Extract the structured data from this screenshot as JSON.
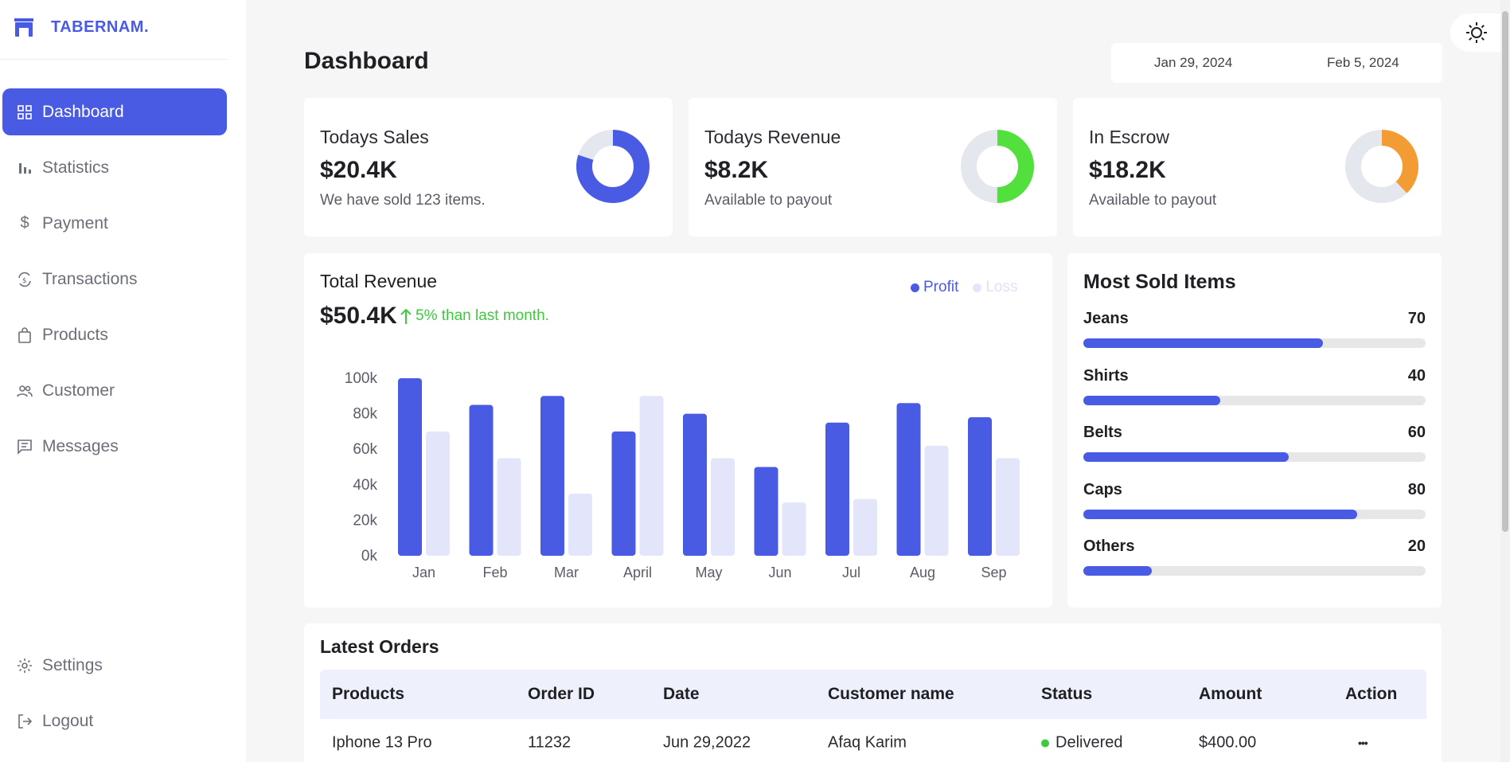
{
  "brand": {
    "name": "TABERNAM."
  },
  "nav": [
    {
      "label": "Dashboard",
      "icon": "grid-icon",
      "active": true
    },
    {
      "label": "Statistics",
      "icon": "bar-chart-icon"
    },
    {
      "label": "Payment",
      "icon": "dollar-icon"
    },
    {
      "label": "Transactions",
      "icon": "exchange-icon"
    },
    {
      "label": "Products",
      "icon": "shopping-bag-icon"
    },
    {
      "label": "Customer",
      "icon": "users-icon"
    },
    {
      "label": "Messages",
      "icon": "message-icon"
    }
  ],
  "nav_bottom": [
    {
      "label": "Settings",
      "icon": "gear-icon"
    },
    {
      "label": "Logout",
      "icon": "logout-icon"
    }
  ],
  "page": {
    "title": "Dashboard"
  },
  "date_range": {
    "start": "Jan 29, 2024",
    "end": "Feb 5, 2024"
  },
  "stats": [
    {
      "title": "Todays Sales",
      "value": "$20.4K",
      "sub": "We have sold 123 items.",
      "color": "#4a5be3",
      "fraction": 0.8
    },
    {
      "title": "Todays Revenue",
      "value": "$8.2K",
      "sub": "Available to payout",
      "color": "#52e03c",
      "fraction": 0.5
    },
    {
      "title": "In Escrow",
      "value": "$18.2K",
      "sub": "Available to payout",
      "color": "#f39c33",
      "fraction": 0.38
    }
  ],
  "revenue": {
    "title": "Total Revenue",
    "value": "$50.4K",
    "growth": "5% than last month.",
    "legend": {
      "profit": "Profit",
      "loss": "Loss"
    }
  },
  "chart_data": {
    "type": "bar",
    "categories": [
      "Jan",
      "Feb",
      "Mar",
      "April",
      "May",
      "Jun",
      "Jul",
      "Aug",
      "Sep"
    ],
    "series": [
      {
        "name": "Profit",
        "color": "#4a5be3",
        "values": [
          100,
          85,
          90,
          70,
          80,
          50,
          75,
          86,
          78
        ]
      },
      {
        "name": "Loss",
        "color": "#e3e6fa",
        "values": [
          70,
          55,
          35,
          90,
          55,
          30,
          32,
          62,
          55
        ]
      }
    ],
    "yticks": [
      "0k",
      "20k",
      "40k",
      "60k",
      "80k",
      "100k"
    ],
    "ylim": [
      0,
      100
    ],
    "grid": false,
    "legend_position": "top-right"
  },
  "most_sold": {
    "title": "Most Sold Items",
    "items": [
      {
        "label": "Jeans",
        "count": "70",
        "value": 70
      },
      {
        "label": "Shirts",
        "count": "40",
        "value": 40
      },
      {
        "label": "Belts",
        "count": "60",
        "value": 60
      },
      {
        "label": "Caps",
        "count": "80",
        "value": 80
      },
      {
        "label": "Others",
        "count": "20",
        "value": 20
      }
    ]
  },
  "orders": {
    "title": "Latest Orders",
    "columns": [
      "Products",
      "Order ID",
      "Date",
      "Customer name",
      "Status",
      "Amount",
      "Action"
    ],
    "rows": [
      {
        "product": "Iphone 13 Pro",
        "order_id": "11232",
        "date": "Jun 29,2022",
        "customer": "Afaq Karim",
        "status": "Delivered",
        "amount": "$400.00",
        "action": "•••"
      }
    ]
  }
}
